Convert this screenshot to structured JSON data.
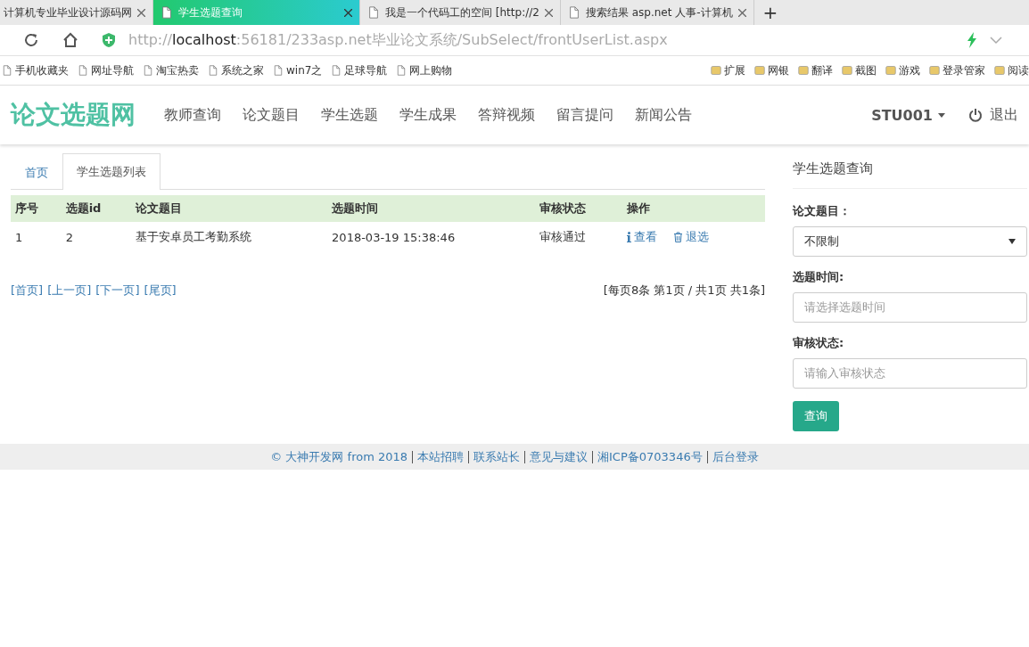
{
  "browser": {
    "tabs": [
      {
        "title": "计算机专业毕业设计源码网",
        "selected": false
      },
      {
        "title": "学生选题查询",
        "selected": true
      },
      {
        "title": "我是一个代码工的空间 [http://2",
        "selected": false
      },
      {
        "title": "搜索结果 asp.net 人事-计算机",
        "selected": false
      }
    ],
    "new_tab": "+",
    "url": {
      "scheme": "http://",
      "host": "localhost",
      "path": ":56181/233asp.net毕业论文系统/SubSelect/frontUserList.aspx"
    },
    "bookmarks": [
      "手机收藏夹",
      "网址导航",
      "淘宝热卖",
      "系统之家",
      "win7之",
      "足球导航",
      "网上购物"
    ],
    "tools": [
      "扩展",
      "网银",
      "翻译",
      "截图",
      "游戏",
      "登录管家",
      "阅读"
    ]
  },
  "site": {
    "logo": "论文选题网",
    "nav": [
      "教师查询",
      "论文题目",
      "学生选题",
      "学生成果",
      "答辩视频",
      "留言提问",
      "新闻公告"
    ],
    "user": "STU001",
    "logout": "退出"
  },
  "tabs": [
    {
      "label": "首页",
      "selected": false
    },
    {
      "label": "学生选题列表",
      "selected": true
    }
  ],
  "table": {
    "columns": [
      "序号",
      "选题id",
      "论文题目",
      "选题时间",
      "审核状态",
      "操作"
    ],
    "rows": [
      {
        "cells": [
          "1",
          "2",
          "基于安卓员工考勤系统",
          "2018-03-19 15:38:46",
          "审核通过"
        ],
        "actions": [
          "查看",
          "退选"
        ]
      }
    ]
  },
  "pager": {
    "links": [
      "[首页]",
      "[上一页]",
      "[下一页]",
      "[尾页]"
    ],
    "summary": "[每页8条 第1页 / 共1页 共1条]"
  },
  "search": {
    "title": "学生选题查询",
    "fields": [
      {
        "kind": "select",
        "label": "论文题目：",
        "value": "不限制"
      },
      {
        "kind": "input",
        "label": "选题时间:",
        "placeholder": "请选择选题时间"
      },
      {
        "kind": "input",
        "label": "审核状态:",
        "placeholder": "请输入审核状态"
      }
    ],
    "button": "查询"
  },
  "footer": [
    "© 大神开发网 from 2018",
    "本站招聘",
    "联系站长",
    "意见与建议",
    "湘ICP备0703346号",
    "后台登录"
  ]
}
